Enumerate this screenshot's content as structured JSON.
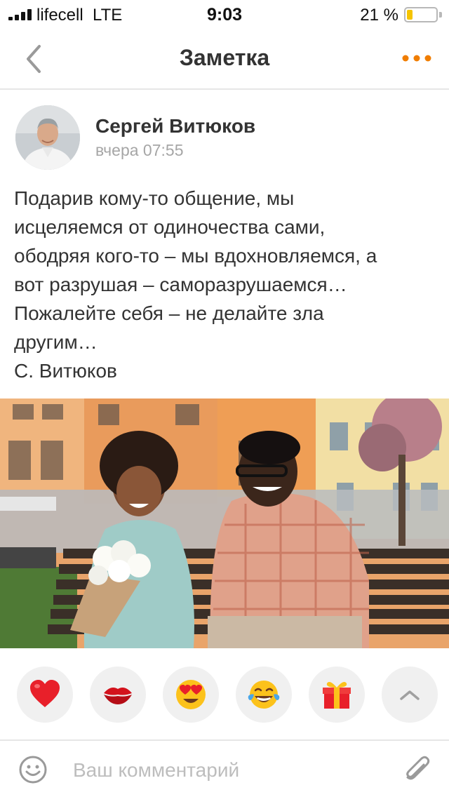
{
  "status_bar": {
    "carrier": "lifecell",
    "network": "LTE",
    "time": "9:03",
    "battery_percent_label": "21 %",
    "battery_level": 0.21,
    "signal_bars": 4
  },
  "nav": {
    "title": "Заметка",
    "accent_color": "#f07d00"
  },
  "post": {
    "author": "Сергей Витюков",
    "time": "вчера 07:55",
    "lines": [
      "Подарив кому-то общение, мы",
      "исцеляемся от одиночества сами,",
      "ободряя кого-то – мы вдохновляемся, а",
      "вот разрушая – саморазрушаемся…",
      "Пожалейте себя – не делайте зла",
      "другим…",
      "С. Витюков"
    ]
  },
  "reactions": [
    {
      "name": "heart",
      "icon": "heart-icon"
    },
    {
      "name": "kiss",
      "icon": "kiss-lips-icon"
    },
    {
      "name": "love-eyes",
      "icon": "heart-eyes-emoji-icon"
    },
    {
      "name": "laugh",
      "icon": "tears-of-joy-emoji-icon"
    },
    {
      "name": "gift",
      "icon": "gift-icon"
    },
    {
      "name": "expand",
      "icon": "chevron-up-icon"
    }
  ],
  "comment": {
    "placeholder": "Ваш комментарий"
  }
}
